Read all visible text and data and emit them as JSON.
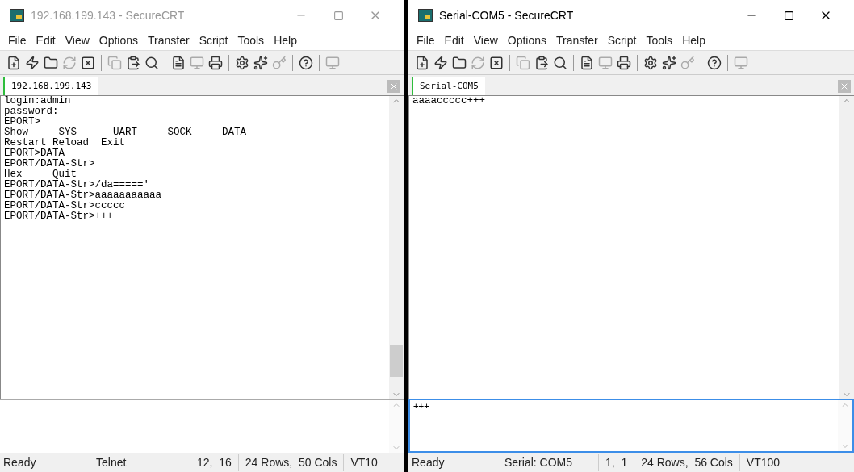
{
  "windows": [
    {
      "title": "192.168.199.143 - SecureCRT",
      "active": false,
      "menu": [
        "File",
        "Edit",
        "View",
        "Options",
        "Transfer",
        "Script",
        "Tools",
        "Help"
      ],
      "tab": "192.168.199.143",
      "terminal_lines": [
        "login:admin",
        "password:",
        "EPORT>",
        "Show     SYS      UART     SOCK     DATA",
        "Restart Reload  Exit",
        "EPORT>DATA",
        "EPORT/DATA-Str>",
        "Hex     Quit",
        "EPORT/DATA-Str>/da=====' ",
        "EPORT/DATA-Str>aaaaaaaaaaa",
        "EPORT/DATA-Str>ccccc",
        "EPORT/DATA-Str>+++"
      ],
      "status": [
        "Ready",
        "Telnet",
        "12,  16",
        "24 Rows,  50 Cols",
        "VT10"
      ]
    },
    {
      "title": "Serial-COM5 - SecureCRT",
      "active": true,
      "menu": [
        "File",
        "Edit",
        "View",
        "Options",
        "Transfer",
        "Script",
        "Tools",
        "Help"
      ],
      "tab": "Serial-COM5",
      "terminal_lines": [
        "aaaaccccc+++"
      ],
      "command_text": "+++",
      "status": [
        "Ready",
        "Serial: COM5",
        "1,  1",
        "24 Rows,  56 Cols",
        "VT100"
      ]
    }
  ]
}
